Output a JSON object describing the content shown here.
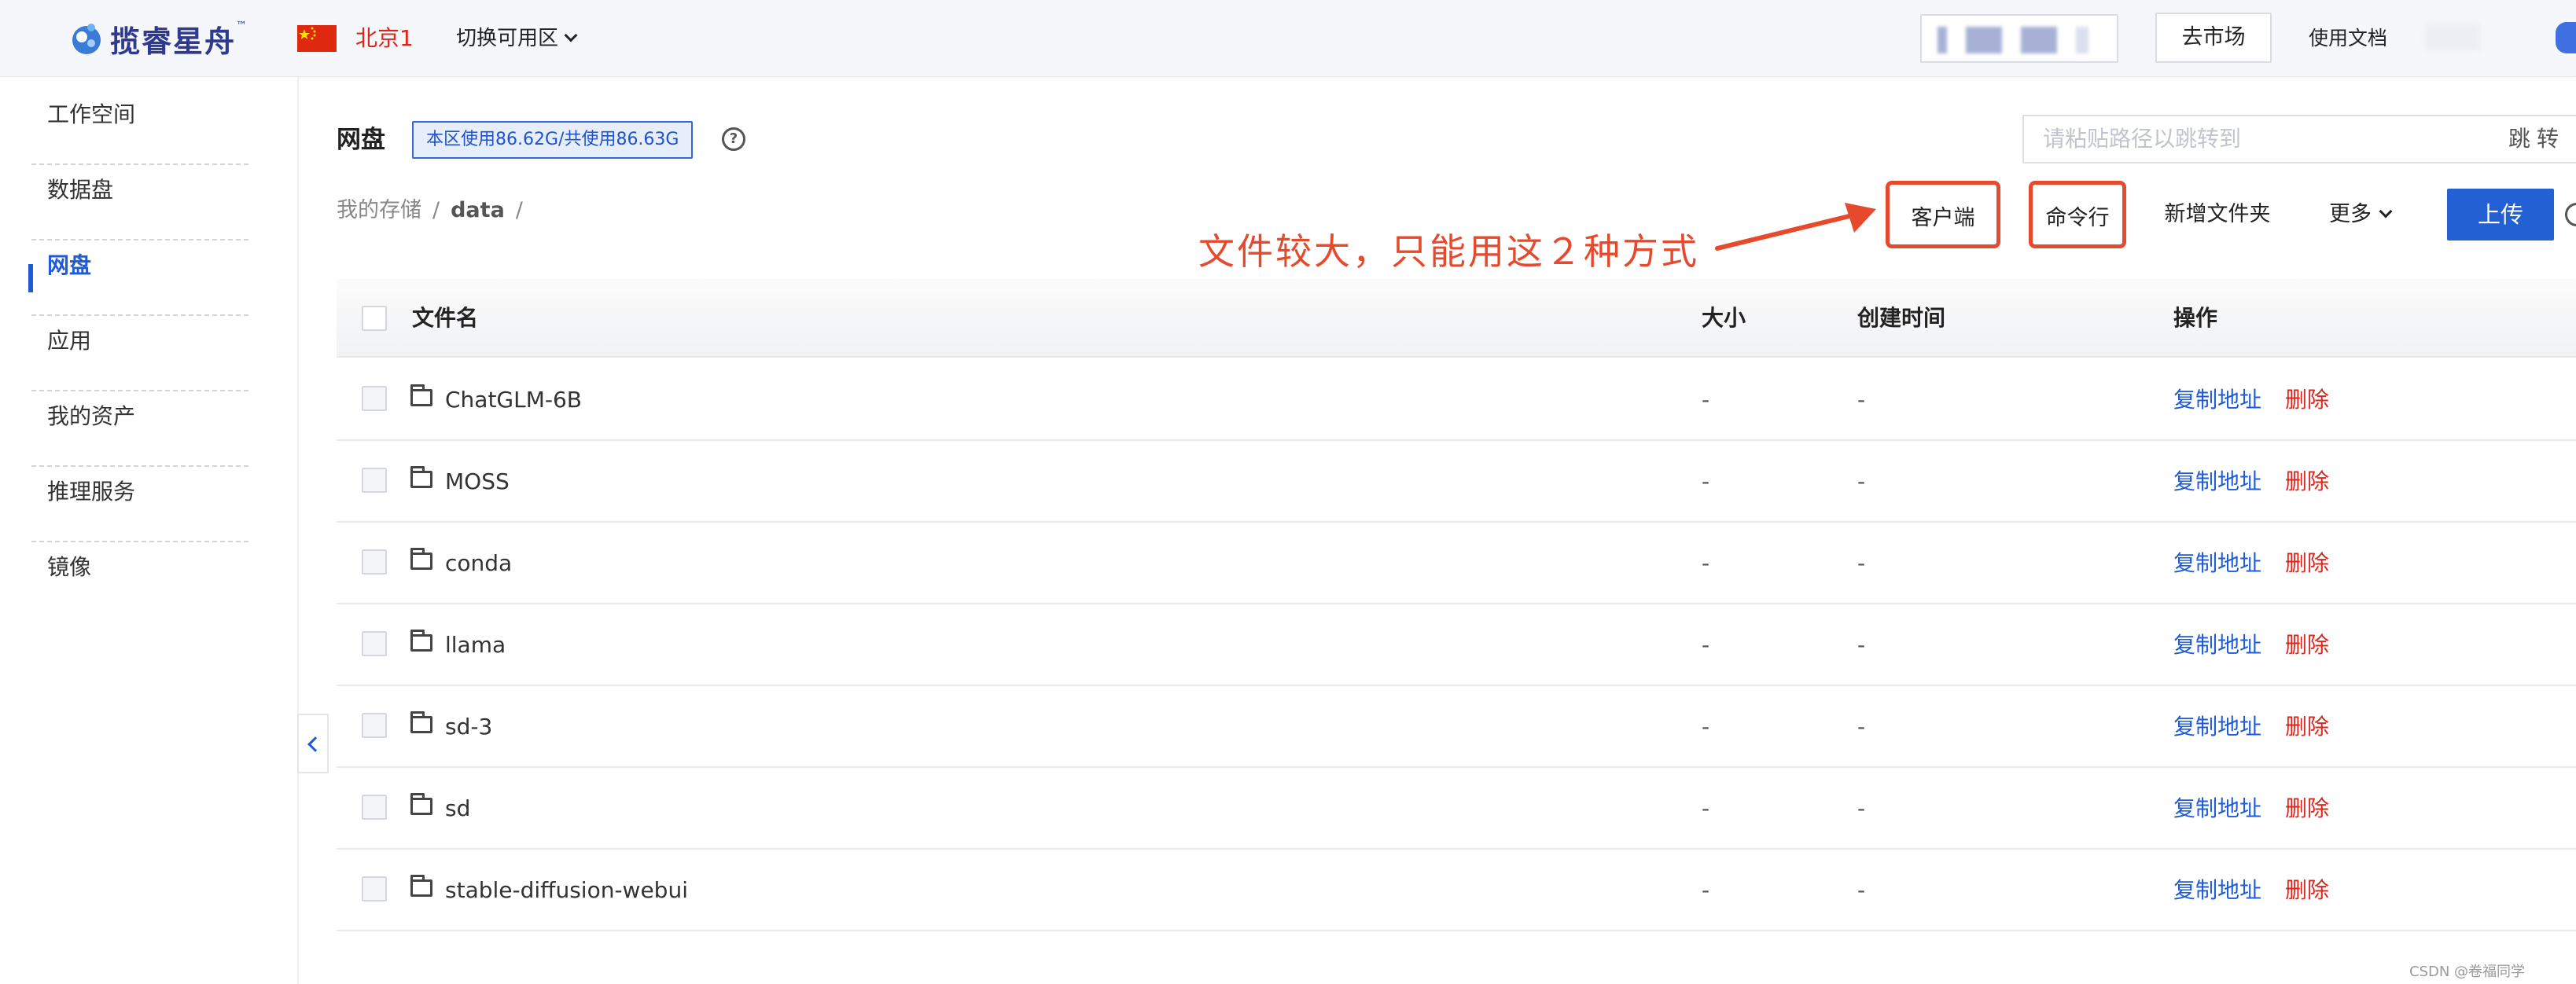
{
  "topbar": {
    "logo_text": "揽睿星舟",
    "logo_tm": "™",
    "region": "北京1",
    "zone_switch": "切换可用区",
    "market_button": "去市场",
    "docs_link": "使用文档"
  },
  "sidebar": {
    "items": [
      {
        "label": "工作空间"
      },
      {
        "label": "数据盘"
      },
      {
        "label": "网盘",
        "active": true
      },
      {
        "label": "应用"
      },
      {
        "label": "我的资产"
      },
      {
        "label": "推理服务"
      },
      {
        "label": "镜像"
      }
    ]
  },
  "header": {
    "title": "网盘",
    "usage": "本区使用86.62G/共使用86.63G",
    "help": "?",
    "path_placeholder": "请粘贴路径以跳转到",
    "jump_button": "跳转"
  },
  "breadcrumb": {
    "root": "我的存储",
    "sep": "/",
    "current": "data"
  },
  "toolbar": {
    "client": "客户端",
    "cli": "命令行",
    "new_folder": "新增文件夹",
    "more": "更多",
    "upload": "上传"
  },
  "annotation": {
    "text": "文件较大，只能用这２种方式",
    "color": "#e64a2c"
  },
  "table": {
    "columns": {
      "name": "文件名",
      "size": "大小",
      "created": "创建时间",
      "actions": "操作"
    },
    "action_copy": "复制地址",
    "action_delete": "删除",
    "rows": [
      {
        "name": "ChatGLM-6B",
        "size": "-",
        "created": "-"
      },
      {
        "name": "MOSS",
        "size": "-",
        "created": "-"
      },
      {
        "name": "conda",
        "size": "-",
        "created": "-"
      },
      {
        "name": "llama",
        "size": "-",
        "created": "-"
      },
      {
        "name": "sd-3",
        "size": "-",
        "created": "-"
      },
      {
        "name": "sd",
        "size": "-",
        "created": "-"
      },
      {
        "name": "stable-diffusion-webui",
        "size": "-",
        "created": "-"
      }
    ]
  },
  "watermark": "CSDN @卷福同学",
  "colors": {
    "accent": "#1d5bd8",
    "danger": "#e2231a",
    "annotation": "#e64a2c"
  }
}
